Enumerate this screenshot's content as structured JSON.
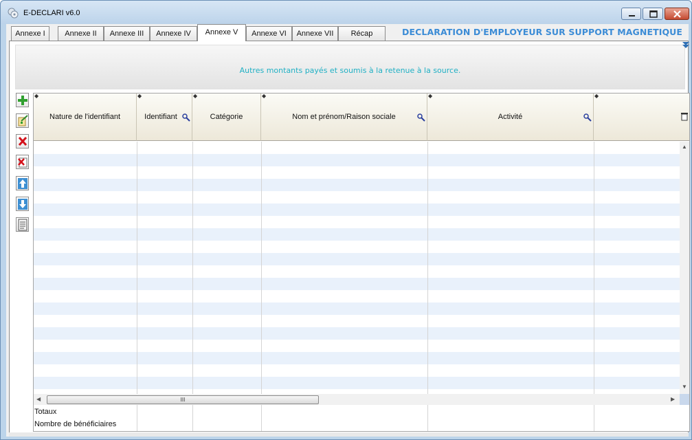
{
  "window": {
    "title": "E-DECLARI v6.0"
  },
  "tabs": [
    "Annexe I",
    "Annexe II",
    "Annexe III",
    "Annexe IV",
    "Annexe V",
    "Annexe VI",
    "Annexe VII",
    "Récap"
  ],
  "active_tab": "Annexe V",
  "banner_title": "DECLARATION D'EMPLOYEUR SUR SUPPORT MAGNETIQUE",
  "header_panel": {
    "info": "Autres montants payés et soumis à la retenue à la source."
  },
  "toolbar": [
    "add-row",
    "edit-row",
    "delete-row",
    "delete-all",
    "move-up",
    "move-down",
    "report"
  ],
  "grid": {
    "columns": [
      "Nature de l'identifiant",
      "Identifiant",
      "Catégorie",
      "Nom et prénom/Raison sociale",
      "Activité"
    ],
    "footer": {
      "totals_label": "Totaux",
      "beneficiaries_label": "Nombre de bénéficiaires"
    },
    "hscroll_thumb_glyph": "III"
  },
  "colors": {
    "banner": "#3c8cd6",
    "info_text": "#20b0c4",
    "row_alt": "#e9f1fb"
  }
}
